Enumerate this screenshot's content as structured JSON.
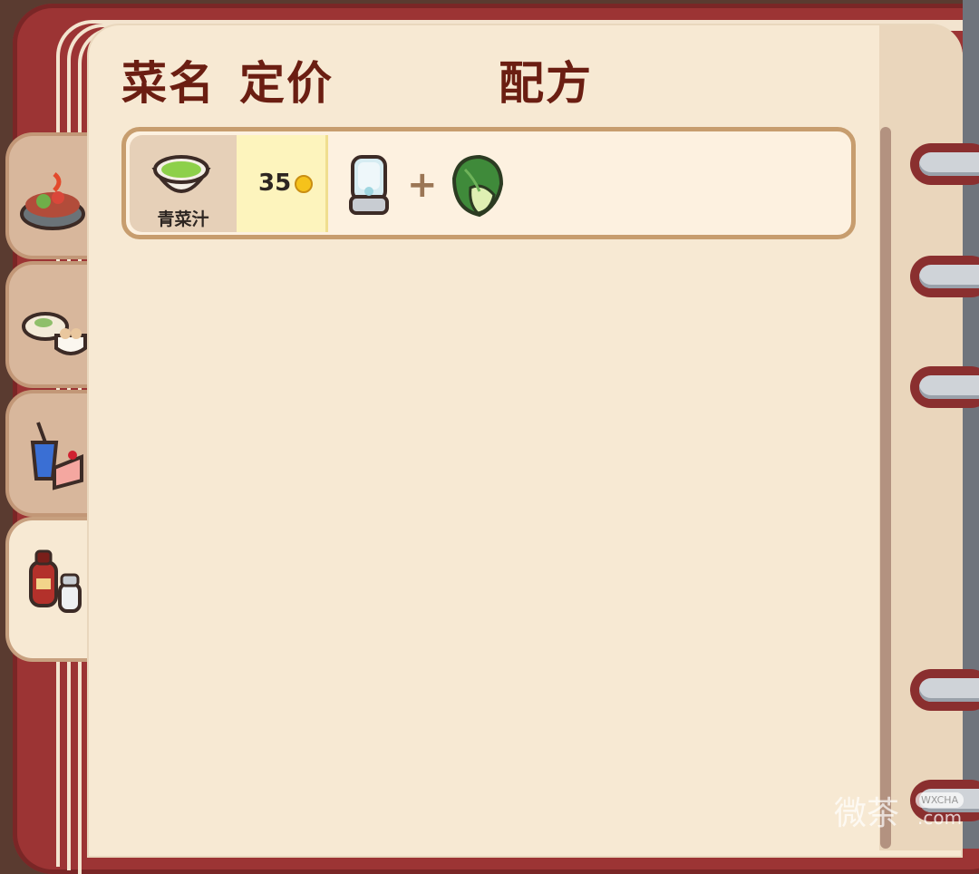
{
  "headers": {
    "name": "菜名",
    "price": "定价",
    "recipe": "配方"
  },
  "tabs": [
    {
      "icon": "stir-fry-dish-icon",
      "active": false
    },
    {
      "icon": "dumplings-bowl-icon",
      "active": false
    },
    {
      "icon": "drink-and-cake-icon",
      "active": false
    },
    {
      "icon": "condiment-bottles-icon",
      "active": true
    }
  ],
  "recipes": [
    {
      "dish_name": "青菜汁",
      "dish_icon": "green-juice-bowl-icon",
      "price": "35",
      "currency_icon": "gold-coin-icon",
      "tool_icon": "blender-icon",
      "plus": "+",
      "ingredient_icon": "bok-choy-icon"
    }
  ],
  "watermark": {
    "text": "微茶",
    "badge": "WXCHA",
    "suffix": ".com"
  },
  "colors": {
    "header": "#6b1e12",
    "row_border": "#c79d6e",
    "price_bg": "#fdf4bd",
    "cover": "#9c3434"
  }
}
